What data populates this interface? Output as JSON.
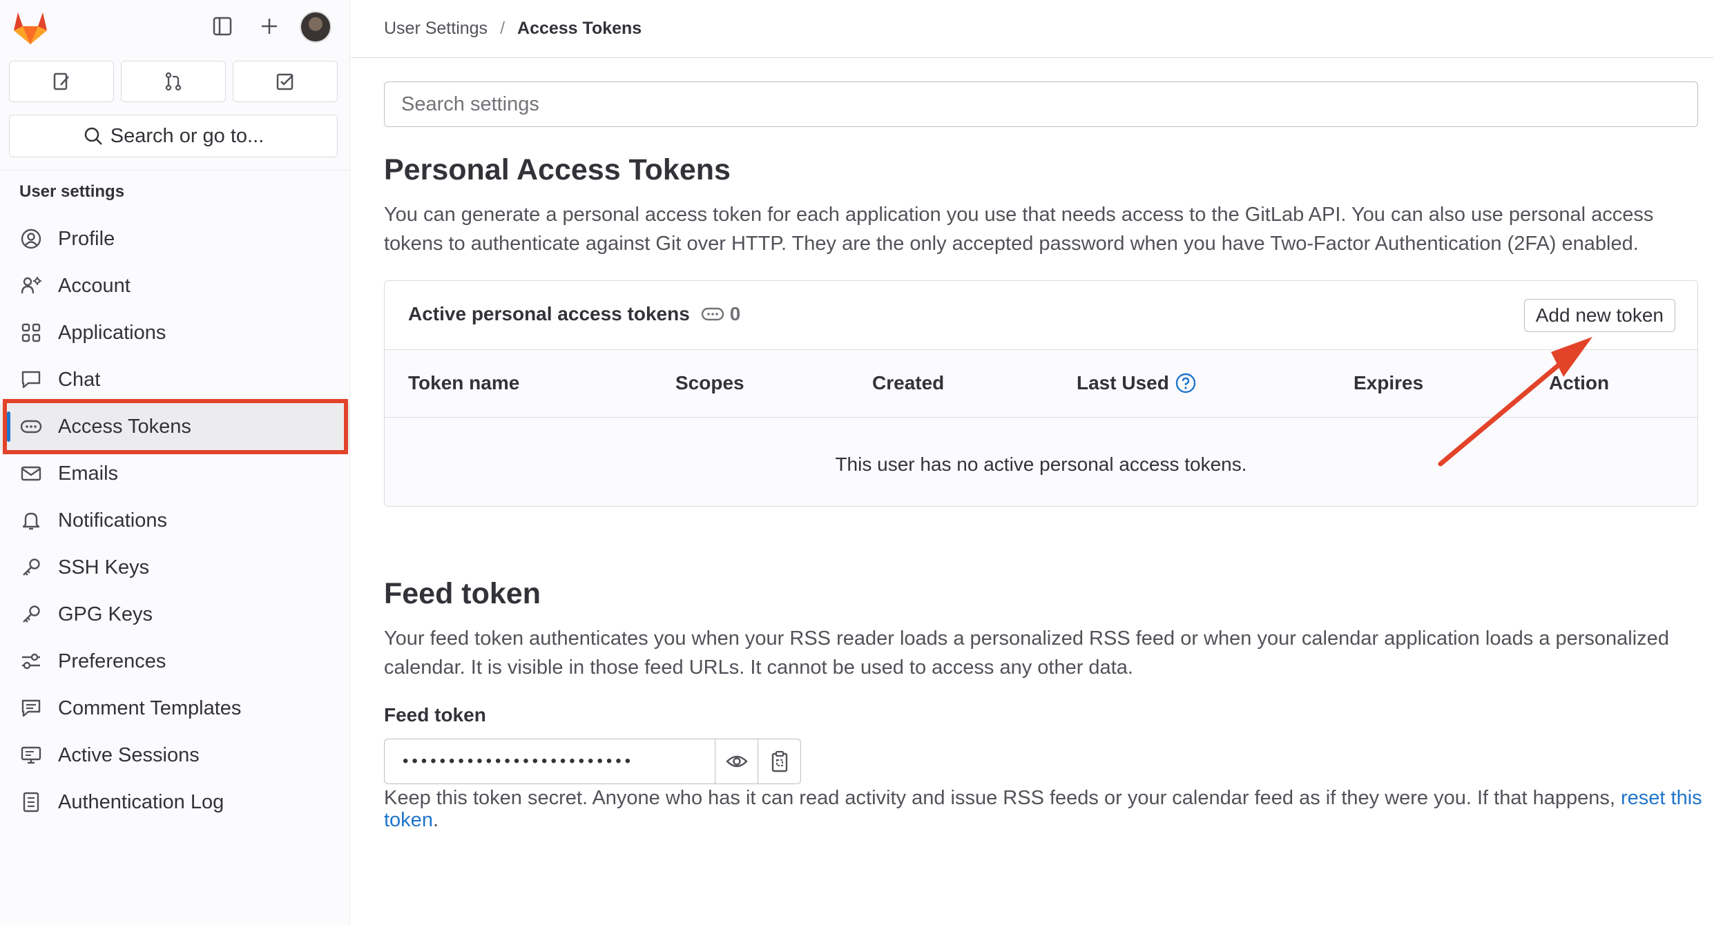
{
  "sidebar": {
    "search_label": "Search or go to...",
    "heading": "User settings",
    "items": [
      {
        "label": "Profile",
        "icon": "profile-icon"
      },
      {
        "label": "Account",
        "icon": "account-icon"
      },
      {
        "label": "Applications",
        "icon": "applications-icon"
      },
      {
        "label": "Chat",
        "icon": "chat-icon"
      },
      {
        "label": "Access Tokens",
        "icon": "token-icon",
        "active": true
      },
      {
        "label": "Emails",
        "icon": "mail-icon"
      },
      {
        "label": "Notifications",
        "icon": "bell-icon"
      },
      {
        "label": "SSH Keys",
        "icon": "key-icon"
      },
      {
        "label": "GPG Keys",
        "icon": "key-icon"
      },
      {
        "label": "Preferences",
        "icon": "preferences-icon"
      },
      {
        "label": "Comment Templates",
        "icon": "comment-icon"
      },
      {
        "label": "Active Sessions",
        "icon": "monitor-icon"
      },
      {
        "label": "Authentication Log",
        "icon": "log-icon"
      }
    ]
  },
  "breadcrumb": {
    "parent": "User Settings",
    "separator": "/",
    "current": "Access Tokens"
  },
  "search": {
    "placeholder": "Search settings"
  },
  "pat": {
    "title": "Personal Access Tokens",
    "description": "You can generate a personal access token for each application you use that needs access to the GitLab API. You can also use personal access tokens to authenticate against Git over HTTP. They are the only accepted password when you have Two-Factor Authentication (2FA) enabled.",
    "card_title": "Active personal access tokens",
    "count": "0",
    "add_button": "Add new token",
    "columns": [
      "Token name",
      "Scopes",
      "Created",
      "Last Used",
      "Expires",
      "Action"
    ],
    "empty_message": "This user has no active personal access tokens."
  },
  "feed": {
    "title": "Feed token",
    "description": "Your feed token authenticates you when your RSS reader loads a personalized RSS feed or when your calendar application loads a personalized calendar. It is visible in those feed URLs. It cannot be used to access any other data.",
    "field_label": "Feed token",
    "masked_value": "•••••••••••••••••••••••••",
    "help_text": "Keep this token secret. Anyone who has it can read activity and issue RSS feeds or your calendar feed as if they were you. If that happens, ",
    "reset_link": "reset this token",
    "help_end": "."
  },
  "colors": {
    "accent": "#1f75cb",
    "highlight": "#e24329",
    "text": "#333238"
  }
}
